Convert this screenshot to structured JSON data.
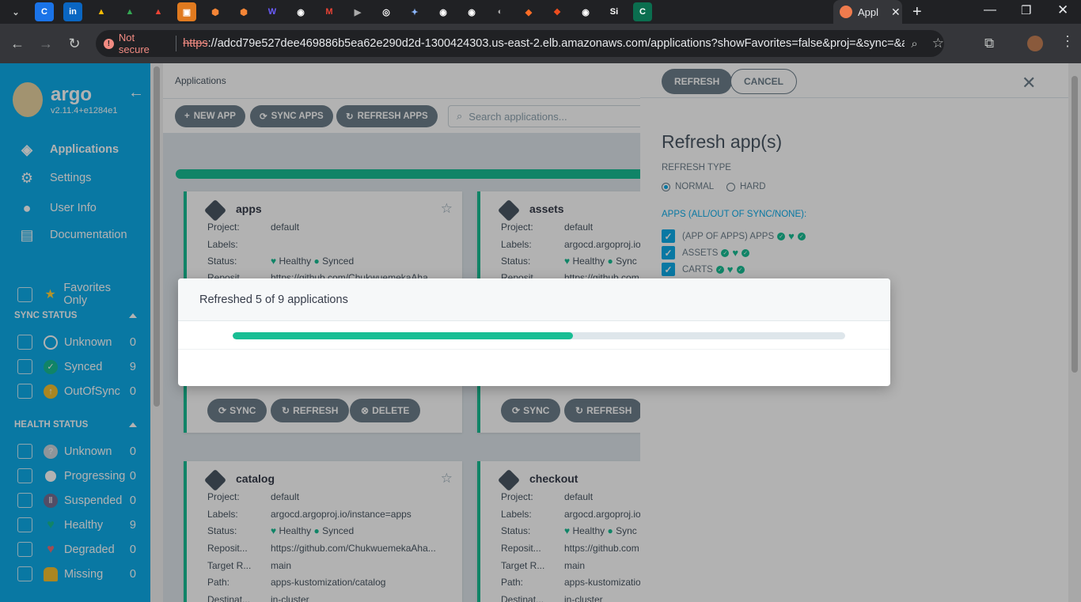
{
  "browser": {
    "active_tab_title": "Appl",
    "not_secure_label": "Not secure",
    "url_scheme": "https",
    "url_rest": "://adcd79e527dee469886b5ea62e290d2d-1300424303.us-east-2.elb.amazonaws.com/applications?showFavorites=false&proj=&sync=&autoSy..."
  },
  "sidebar": {
    "logo_text": "argo",
    "version": "v2.11.4+e1284e1",
    "nav": [
      {
        "label": "Applications"
      },
      {
        "label": "Settings"
      },
      {
        "label": "User Info"
      },
      {
        "label": "Documentation"
      }
    ],
    "favorites_label": "Favorites Only",
    "sync_status_title": "SYNC STATUS",
    "sync_filters": [
      {
        "label": "Unknown",
        "count": "0"
      },
      {
        "label": "Synced",
        "count": "9"
      },
      {
        "label": "OutOfSync",
        "count": "0"
      }
    ],
    "health_status_title": "HEALTH STATUS",
    "health_filters": [
      {
        "label": "Unknown",
        "count": "0"
      },
      {
        "label": "Progressing",
        "count": "0"
      },
      {
        "label": "Suspended",
        "count": "0"
      },
      {
        "label": "Healthy",
        "count": "9"
      },
      {
        "label": "Degraded",
        "count": "0"
      },
      {
        "label": "Missing",
        "count": "0"
      }
    ]
  },
  "main": {
    "breadcrumb": "Applications",
    "new_app": "NEW APP",
    "sync_apps": "SYNC APPS",
    "refresh_apps": "REFRESH APPS",
    "search_placeholder": "Search applications...",
    "cards": [
      {
        "name": "apps",
        "project": "default",
        "labels": "",
        "health": "Healthy",
        "sync": "Synced",
        "repo": "https://github.com/ChukwuemekaAha..."
      },
      {
        "name": "assets",
        "project": "default",
        "labels": "argocd.argoproj.io",
        "health": "Healthy",
        "sync": "Sync",
        "repo": "https://github.com"
      },
      {
        "name": "catalog",
        "project": "default",
        "labels": "argocd.argoproj.io/instance=apps",
        "health": "Healthy",
        "sync": "Synced",
        "repo": "https://github.com/ChukwuemekaAha...",
        "target": "main",
        "path": "apps-kustomization/catalog",
        "dest": "in-cluster"
      },
      {
        "name": "checkout",
        "project": "default",
        "labels": "argocd.argoproj.io",
        "health": "Healthy",
        "sync": "Sync",
        "repo": "https://github.com",
        "target": "main",
        "path": "apps-kustomizatio",
        "dest": "in-cluster"
      }
    ],
    "field_labels": {
      "project": "Project:",
      "labels": "Labels:",
      "status": "Status:",
      "repo": "Reposit...",
      "target": "Target R...",
      "path": "Path:",
      "dest": "Destinat..."
    },
    "card_buttons": {
      "sync": "SYNC",
      "refresh": "REFRESH",
      "delete": "DELETE"
    }
  },
  "panel": {
    "refresh_btn": "REFRESH",
    "cancel_btn": "CANCEL",
    "title": "Refresh app(s)",
    "refresh_type_label": "REFRESH TYPE",
    "normal": "NORMAL",
    "hard": "HARD",
    "apps_label": "APPS (ALL/OUT OF SYNC/NONE):",
    "apps": [
      "(APP OF APPS) APPS",
      "ASSETS",
      "CARTS"
    ]
  },
  "modal": {
    "title": "Refreshed 5 of 9 applications",
    "progress_fraction": 0.556
  },
  "colors": {
    "accent": "#18be94",
    "sidebar": "#0dadea"
  }
}
